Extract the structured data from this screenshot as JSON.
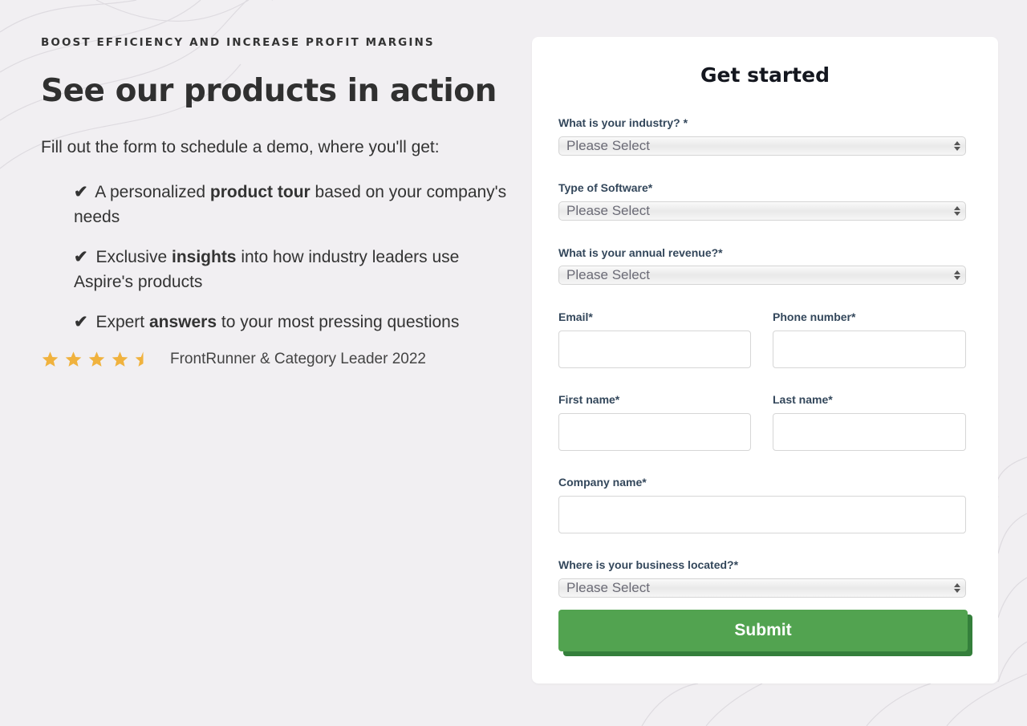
{
  "hero": {
    "eyebrow": "BOOST EFFICIENCY AND INCREASE PROFIT MARGINS",
    "headline": "See our products in action",
    "intro": "Fill out the form to schedule a demo, where you'll get:",
    "benefits": [
      {
        "check": "✔",
        "pre": " A personalized ",
        "bold": "product tour",
        "post": " based on your company's needs"
      },
      {
        "check": "✔",
        "pre": " Exclusive ",
        "bold": "insights",
        "post": " into how industry leaders use Aspire's products"
      },
      {
        "check": "✔",
        "pre": " Expert ",
        "bold": "answers",
        "post": " to your most pressing questions"
      }
    ],
    "rating": {
      "stars": 4.5,
      "max": 5,
      "color": "#f0b23e",
      "text": "FrontRunner & Category Leader 2022"
    }
  },
  "form": {
    "title": "Get started",
    "industry": {
      "label": "What is your industry? *",
      "value": "Please Select"
    },
    "software": {
      "label": "Type of Software*",
      "value": "Please Select"
    },
    "revenue": {
      "label": "What is your annual revenue?*",
      "value": "Please Select"
    },
    "email": {
      "label": "Email*",
      "value": ""
    },
    "phone": {
      "label": "Phone number*",
      "value": ""
    },
    "first_name": {
      "label": "First name*",
      "value": ""
    },
    "last_name": {
      "label": "Last name*",
      "value": ""
    },
    "company": {
      "label": "Company name*",
      "value": ""
    },
    "location": {
      "label": "Where is your business located?*",
      "value": "Please Select"
    },
    "submit_label": "Submit",
    "submit_color": "#52a350"
  }
}
